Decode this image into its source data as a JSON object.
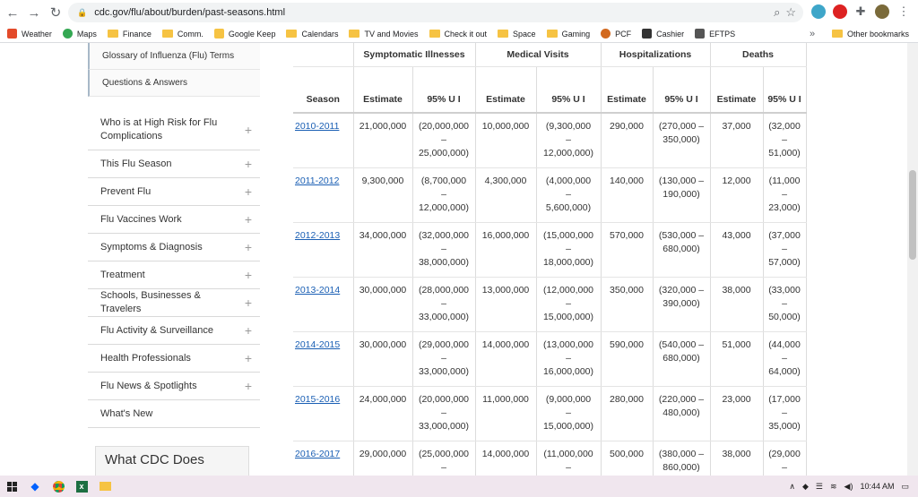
{
  "browser": {
    "url": "cdc.gov/flu/about/burden/past-seasons.html"
  },
  "bookmarks": [
    {
      "label": "Weather",
      "kind": "weather"
    },
    {
      "label": "Maps",
      "kind": "maps"
    },
    {
      "label": "Finance",
      "kind": "folder"
    },
    {
      "label": "Comm.",
      "kind": "folder"
    },
    {
      "label": "Google Keep",
      "kind": "keep"
    },
    {
      "label": "Calendars",
      "kind": "folder"
    },
    {
      "label": "TV and Movies",
      "kind": "folder"
    },
    {
      "label": "Check it out",
      "kind": "folder"
    },
    {
      "label": "Space",
      "kind": "folder"
    },
    {
      "label": "Gaming",
      "kind": "folder"
    },
    {
      "label": "PCF",
      "kind": "pcf"
    },
    {
      "label": "Cashier",
      "kind": "cashier"
    },
    {
      "label": "EFTPS",
      "kind": "eftps"
    }
  ],
  "other_bookmarks": "Other bookmarks",
  "overflow": "»",
  "sidebar": {
    "sub_items": [
      "Glossary of Influenza (Flu) Terms",
      "Questions & Answers"
    ],
    "items": [
      {
        "label": "Who is at High Risk for Flu Complications",
        "expandable": true
      },
      {
        "label": "This Flu Season",
        "expandable": true
      },
      {
        "label": "Prevent Flu",
        "expandable": true
      },
      {
        "label": "Flu Vaccines Work",
        "expandable": true
      },
      {
        "label": "Symptoms & Diagnosis",
        "expandable": true
      },
      {
        "label": "Treatment",
        "expandable": true
      },
      {
        "label": "Schools, Businesses & Travelers",
        "expandable": true
      },
      {
        "label": "Flu Activity & Surveillance",
        "expandable": true
      },
      {
        "label": "Health Professionals",
        "expandable": true
      },
      {
        "label": "Flu News & Spotlights",
        "expandable": true
      },
      {
        "label": "What's New",
        "expandable": false
      }
    ],
    "what_cdc_does": "What CDC Does"
  },
  "table": {
    "groups": [
      "Symptomatic Illnesses",
      "Medical Visits",
      "Hospitalizations",
      "Deaths"
    ],
    "headers": [
      "Season",
      "Estimate",
      "95% U I",
      "Estimate",
      "95% U I",
      "Estimate",
      "95% U I",
      "Estimate",
      "95% U I"
    ],
    "rows": [
      [
        "2010-2011",
        "21,000,000",
        "(20,000,000\n–\n25,000,000)",
        "10,000,000",
        "(9,300,000\n–\n12,000,000)",
        "290,000",
        "(270,000 –\n350,000)",
        "37,000",
        "(32,000\n–\n51,000)"
      ],
      [
        "2011-2012",
        "9,300,000",
        "(8,700,000\n–\n12,000,000)",
        "4,300,000",
        "(4,000,000\n–\n5,600,000)",
        "140,000",
        "(130,000 –\n190,000)",
        "12,000",
        "(11,000\n–\n23,000)"
      ],
      [
        "2012-2013",
        "34,000,000",
        "(32,000,000\n–\n38,000,000)",
        "16,000,000",
        "(15,000,000\n–\n18,000,000)",
        "570,000",
        "(530,000 –\n680,000)",
        "43,000",
        "(37,000\n–\n57,000)"
      ],
      [
        "2013-2014",
        "30,000,000",
        "(28,000,000\n–\n33,000,000)",
        "13,000,000",
        "(12,000,000\n–\n15,000,000)",
        "350,000",
        "(320,000 –\n390,000)",
        "38,000",
        "(33,000\n–\n50,000)"
      ],
      [
        "2014-2015",
        "30,000,000",
        "(29,000,000\n–\n33,000,000)",
        "14,000,000",
        "(13,000,000\n–\n16,000,000)",
        "590,000",
        "(540,000 –\n680,000)",
        "51,000",
        "(44,000\n–\n64,000)"
      ],
      [
        "2015-2016",
        "24,000,000",
        "(20,000,000\n–\n33,000,000)",
        "11,000,000",
        "(9,000,000\n–\n15,000,000)",
        "280,000",
        "(220,000 –\n480,000)",
        "23,000",
        "(17,000\n–\n35,000)"
      ],
      [
        "2016-2017",
        "29,000,000",
        "(25,000,000\n–",
        "14,000,000",
        "(11,000,000\n–",
        "500,000",
        "(380,000 –\n860,000)",
        "38,000",
        "(29,000\n–"
      ]
    ]
  },
  "taskbar": {
    "time": "10:44 AM"
  }
}
